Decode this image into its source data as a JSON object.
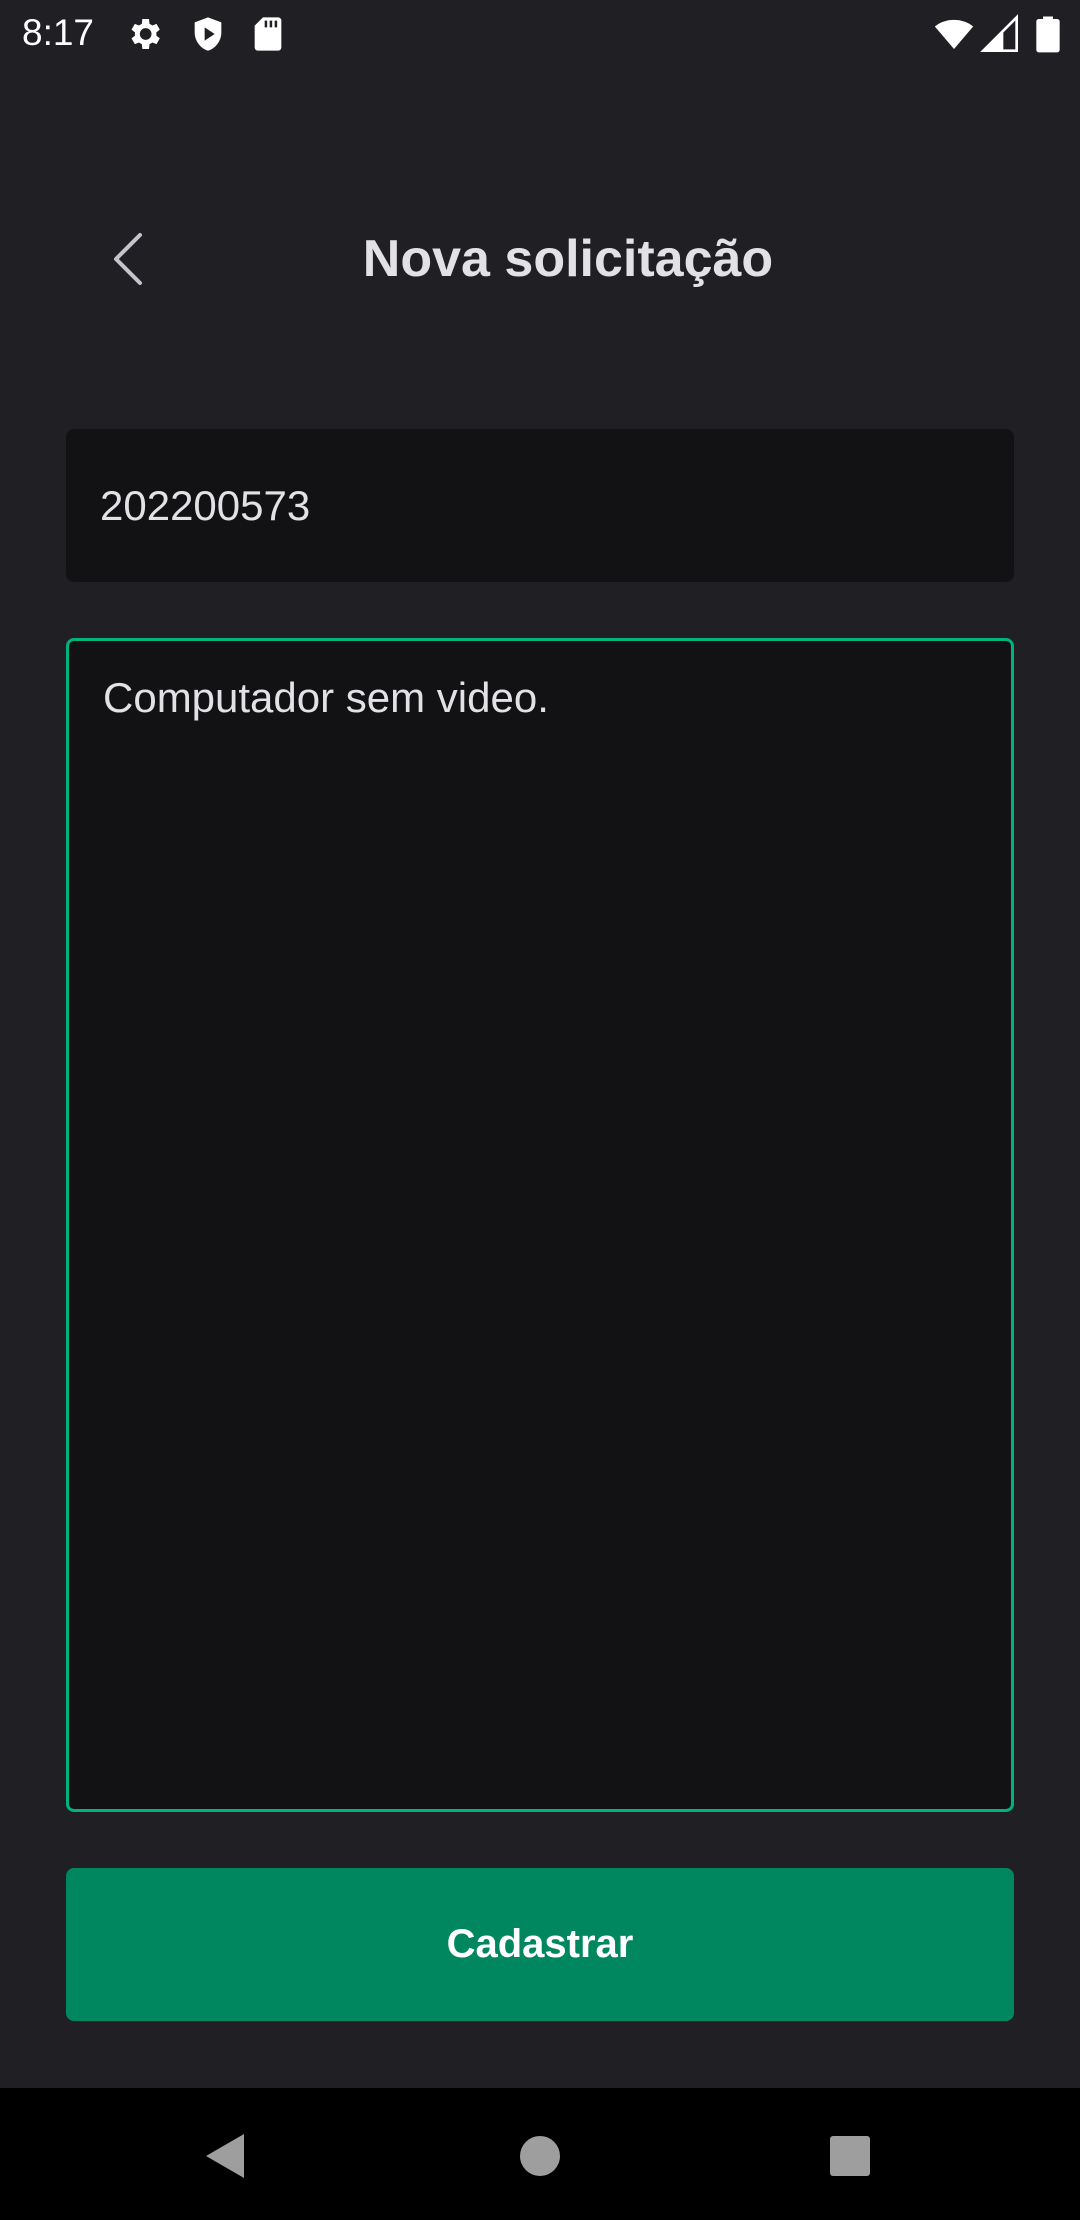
{
  "status_bar": {
    "time": "8:17",
    "icons": [
      "settings-icon",
      "shield-play-icon",
      "sd-card-icon",
      "wifi-icon",
      "signal-icon",
      "battery-icon"
    ]
  },
  "header": {
    "title": "Nova solicitação",
    "back_icon": "chevron-left-icon"
  },
  "form": {
    "patrimony_value": "202200573",
    "description_value": "Computador sem video.",
    "submit_label": "Cadastrar"
  },
  "navigation": {
    "icons": [
      "back-triangle-icon",
      "home-circle-icon",
      "recents-square-icon"
    ]
  },
  "colors": {
    "background": "#202024",
    "input_background": "#121214",
    "accent": "#00b37e",
    "button": "#00875f",
    "text": "#e1e1e6"
  }
}
